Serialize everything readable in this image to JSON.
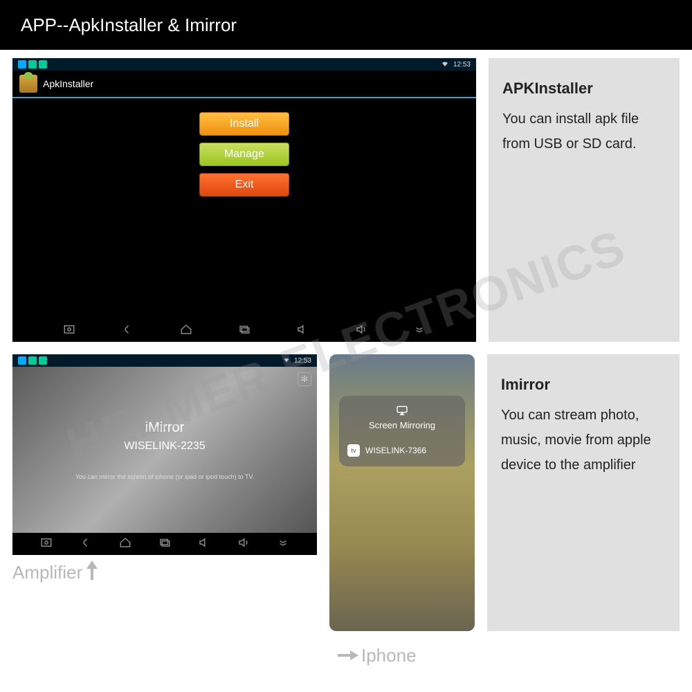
{
  "header": {
    "title": "APP--ApkInstaller & Imirror"
  },
  "watermark": "HELMER ELECTRONICS",
  "apk": {
    "status_time": "12:53",
    "app_title": "ApkInstaller",
    "buttons": {
      "install": "Install",
      "manage": "Manage",
      "exit": "Exit"
    }
  },
  "info_apk": {
    "title": "APKInstaller",
    "body": "You can install apk file from USB or SD card."
  },
  "imirror": {
    "status_time": "12:53",
    "title": "iMirror",
    "device": "WISELINK-2235",
    "note": "You can mirror the screen of iphone (or ipad or ipod touch) to TV."
  },
  "iphone_sm": {
    "heading": "Screen Mirroring",
    "item": "WISELINK-7366"
  },
  "info_imirror": {
    "title": "Imirror",
    "body": "You can stream photo, music, movie from apple device to the amplifier"
  },
  "labels": {
    "amplifier": "Amplifier",
    "iphone": "Iphone"
  }
}
